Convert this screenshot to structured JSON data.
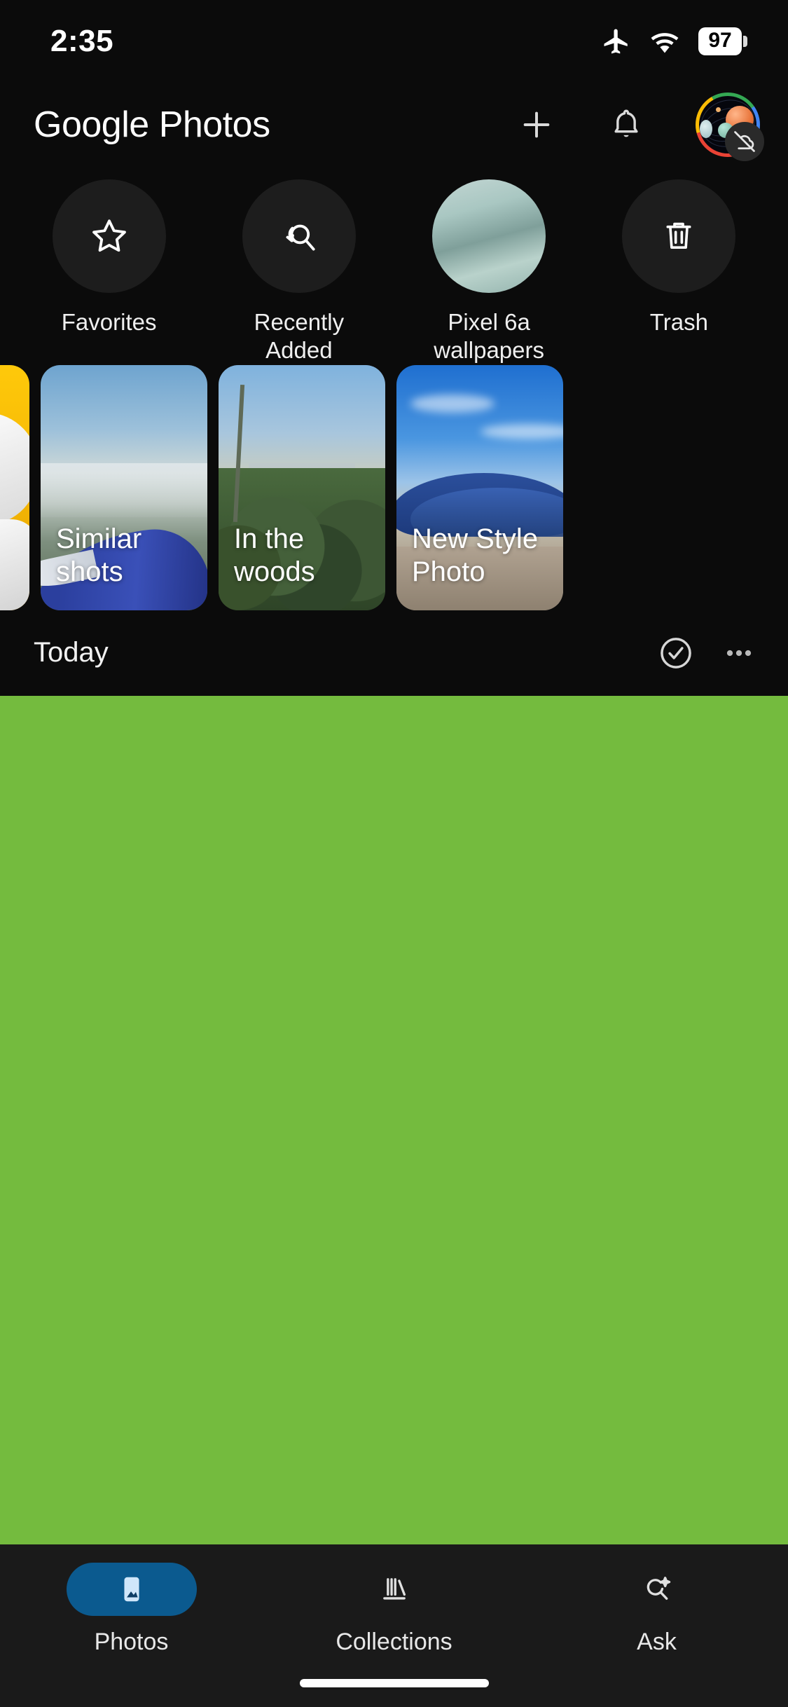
{
  "status_bar": {
    "time": "2:35",
    "battery_percent": "97",
    "icons": [
      "airplane-mode-icon",
      "wifi-icon",
      "battery-icon"
    ]
  },
  "app_bar": {
    "brand_google": "Google",
    "brand_photos": "Photos",
    "actions": [
      {
        "name": "add-button",
        "icon": "plus-icon"
      },
      {
        "name": "notifications-button",
        "icon": "bell-icon"
      },
      {
        "name": "account-avatar",
        "icon": "avatar",
        "badge": "cloud-off-icon"
      }
    ]
  },
  "quick_access": {
    "items": [
      {
        "label": "Favorites",
        "icon": "star-icon",
        "kind": "icon"
      },
      {
        "label": "Recently Added",
        "icon": "history-search-icon",
        "kind": "icon"
      },
      {
        "label": "Pixel 6a wallpapers",
        "icon": "album-thumbnail",
        "kind": "thumbnail"
      },
      {
        "label": "Trash",
        "icon": "trash-icon",
        "kind": "icon"
      }
    ]
  },
  "memories": {
    "cards": [
      {
        "title": "",
        "image": "person-silhouette-yellow"
      },
      {
        "title": "Similar shots",
        "image": "airplane-wing-over-coast"
      },
      {
        "title": "In the woods",
        "image": "forest-and-city-skyline"
      },
      {
        "title": "New Style\nPhoto",
        "image": "blue-canopy-building"
      }
    ]
  },
  "timeline": {
    "section_label": "Today",
    "actions": [
      {
        "name": "select-button",
        "icon": "check-circle-icon"
      },
      {
        "name": "overflow-menu-button",
        "icon": "more-horizontal-icon"
      }
    ]
  },
  "bottom_nav": {
    "items": [
      {
        "label": "Photos",
        "icon": "photo-icon",
        "active": true
      },
      {
        "label": "Collections",
        "icon": "collections-icon",
        "active": false
      },
      {
        "label": "Ask",
        "icon": "ask-sparkle-icon",
        "active": false
      }
    ]
  },
  "colors": {
    "background": "#0b0b0b",
    "content_green": "#74bb3e",
    "nav_background": "#1a1a1a",
    "active_pill": "#0b5a8f",
    "memory_yellow": "#ffc90a",
    "google_red": "#ea4335",
    "google_yellow": "#fbbc04",
    "google_green": "#34a853",
    "google_blue": "#4285f4"
  }
}
